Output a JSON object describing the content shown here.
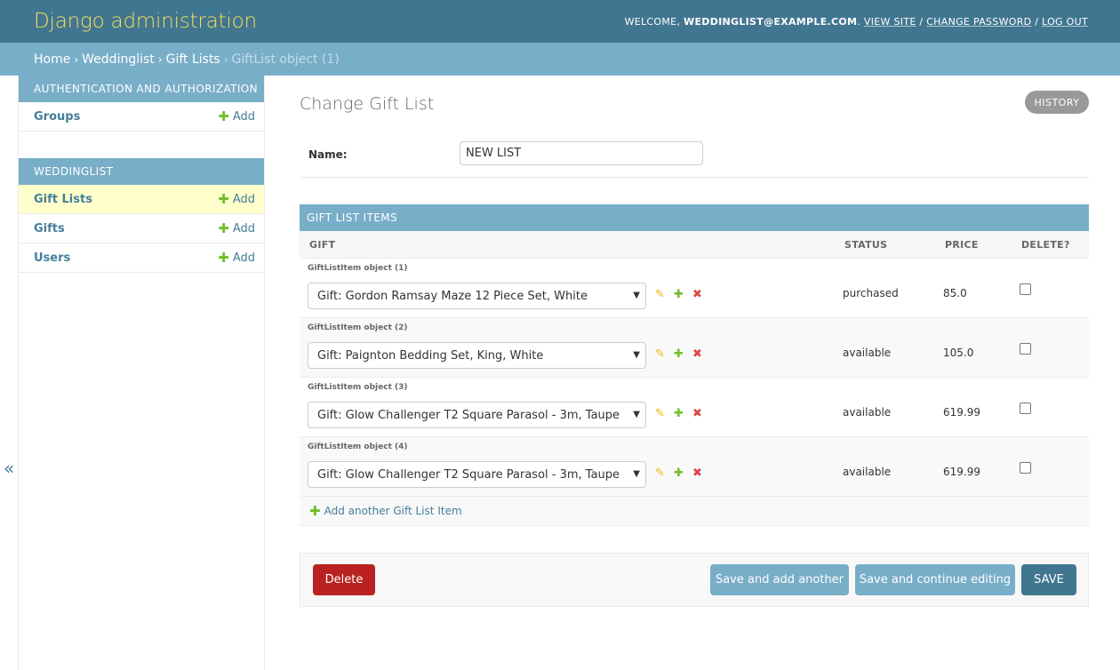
{
  "header": {
    "branding": "Django administration",
    "welcome": "Welcome,",
    "username": "weddinglist@example.com",
    "view_site": "View site",
    "change_password": "Change password",
    "log_out": "Log out",
    "separator": "/"
  },
  "breadcrumbs": {
    "home": "Home",
    "app": "Weddinglist",
    "model": "Gift Lists",
    "current": "GiftList object (1)",
    "separator": "›"
  },
  "sidebar": {
    "toggle_glyph": "«",
    "modules": [
      {
        "caption": "Authentication and Authorization",
        "items": [
          {
            "label": "Groups",
            "add": "Add"
          }
        ]
      },
      {
        "caption": "Weddinglist",
        "items": [
          {
            "label": "Gift Lists",
            "add": "Add"
          },
          {
            "label": "Gifts",
            "add": "Add"
          },
          {
            "label": "Users",
            "add": "Add"
          }
        ]
      }
    ]
  },
  "page": {
    "title": "Change Gift List",
    "history": "History"
  },
  "form": {
    "name_label": "Name:",
    "name_value": "NEW LIST"
  },
  "inline": {
    "caption": "Gift List Items",
    "columns": [
      "Gift",
      "Status",
      "Price",
      "Delete?"
    ],
    "items": [
      {
        "label": "GiftListItem object (1)",
        "gift": "Gift: Gordon Ramsay Maze 12 Piece Set, White",
        "status": "purchased",
        "price": "85.0"
      },
      {
        "label": "GiftListItem object (2)",
        "gift": "Gift: Paignton Bedding Set, King, White",
        "status": "available",
        "price": "105.0"
      },
      {
        "label": "GiftListItem object (3)",
        "gift": "Gift: Glow Challenger T2 Square Parasol - 3m, Taupe",
        "status": "available",
        "price": "619.99"
      },
      {
        "label": "GiftListItem object (4)",
        "gift": "Gift: Glow Challenger T2 Square Parasol - 3m, Taupe",
        "status": "available",
        "price": "619.99"
      }
    ],
    "add_another": "Add another Gift List Item"
  },
  "submit": {
    "delete": "Delete",
    "save_add_another": "Save and add another",
    "save_continue": "Save and continue editing",
    "save": "Save"
  },
  "colors": {
    "header_bg": "#417690",
    "branding": "#f5dd5d",
    "breadcrumb_bg": "#79aec8",
    "link": "#447e9b",
    "add_green": "#70bf2b",
    "current_row": "#ffffcc",
    "delete_red": "#ba2121"
  },
  "icons": {
    "add": "plus-icon",
    "edit": "pencil-icon",
    "delete": "x-icon",
    "toggle": "double-chevron-left-icon"
  }
}
